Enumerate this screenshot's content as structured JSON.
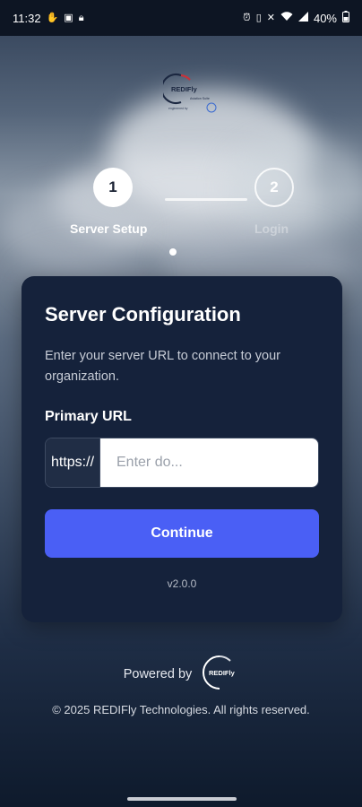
{
  "status_bar": {
    "time": "11:32",
    "battery": "40%",
    "left_icons": [
      "hand-icon",
      "notification-icon",
      "lock-icon"
    ],
    "right_icons": [
      "alarm-icon",
      "vibrate-icon",
      "mute-icon",
      "wifi-icon",
      "signal-icon",
      "battery-icon"
    ]
  },
  "logo": {
    "brand": "REDIFly",
    "tagline": "Aviation Suite",
    "engineered_by": "engineered by"
  },
  "stepper": {
    "steps": [
      {
        "number": "1",
        "label": "Server Setup",
        "active": true
      },
      {
        "number": "2",
        "label": "Login",
        "active": false
      }
    ]
  },
  "card": {
    "title": "Server Configuration",
    "description": "Enter your server URL to connect to your organization.",
    "field_label": "Primary URL",
    "url_prefix": "https://",
    "url_placeholder": "Enter do...",
    "url_value": "",
    "continue_label": "Continue",
    "version": "v2.0.0"
  },
  "footer": {
    "powered_by": "Powered by",
    "powered_logo_text": "REDIFly",
    "copyright": "© 2025 REDIFly Technologies. All rights reserved."
  },
  "colors": {
    "accent": "#4a5ff5",
    "card_bg": "#15223b",
    "status_bar_bg": "#0d1523"
  }
}
